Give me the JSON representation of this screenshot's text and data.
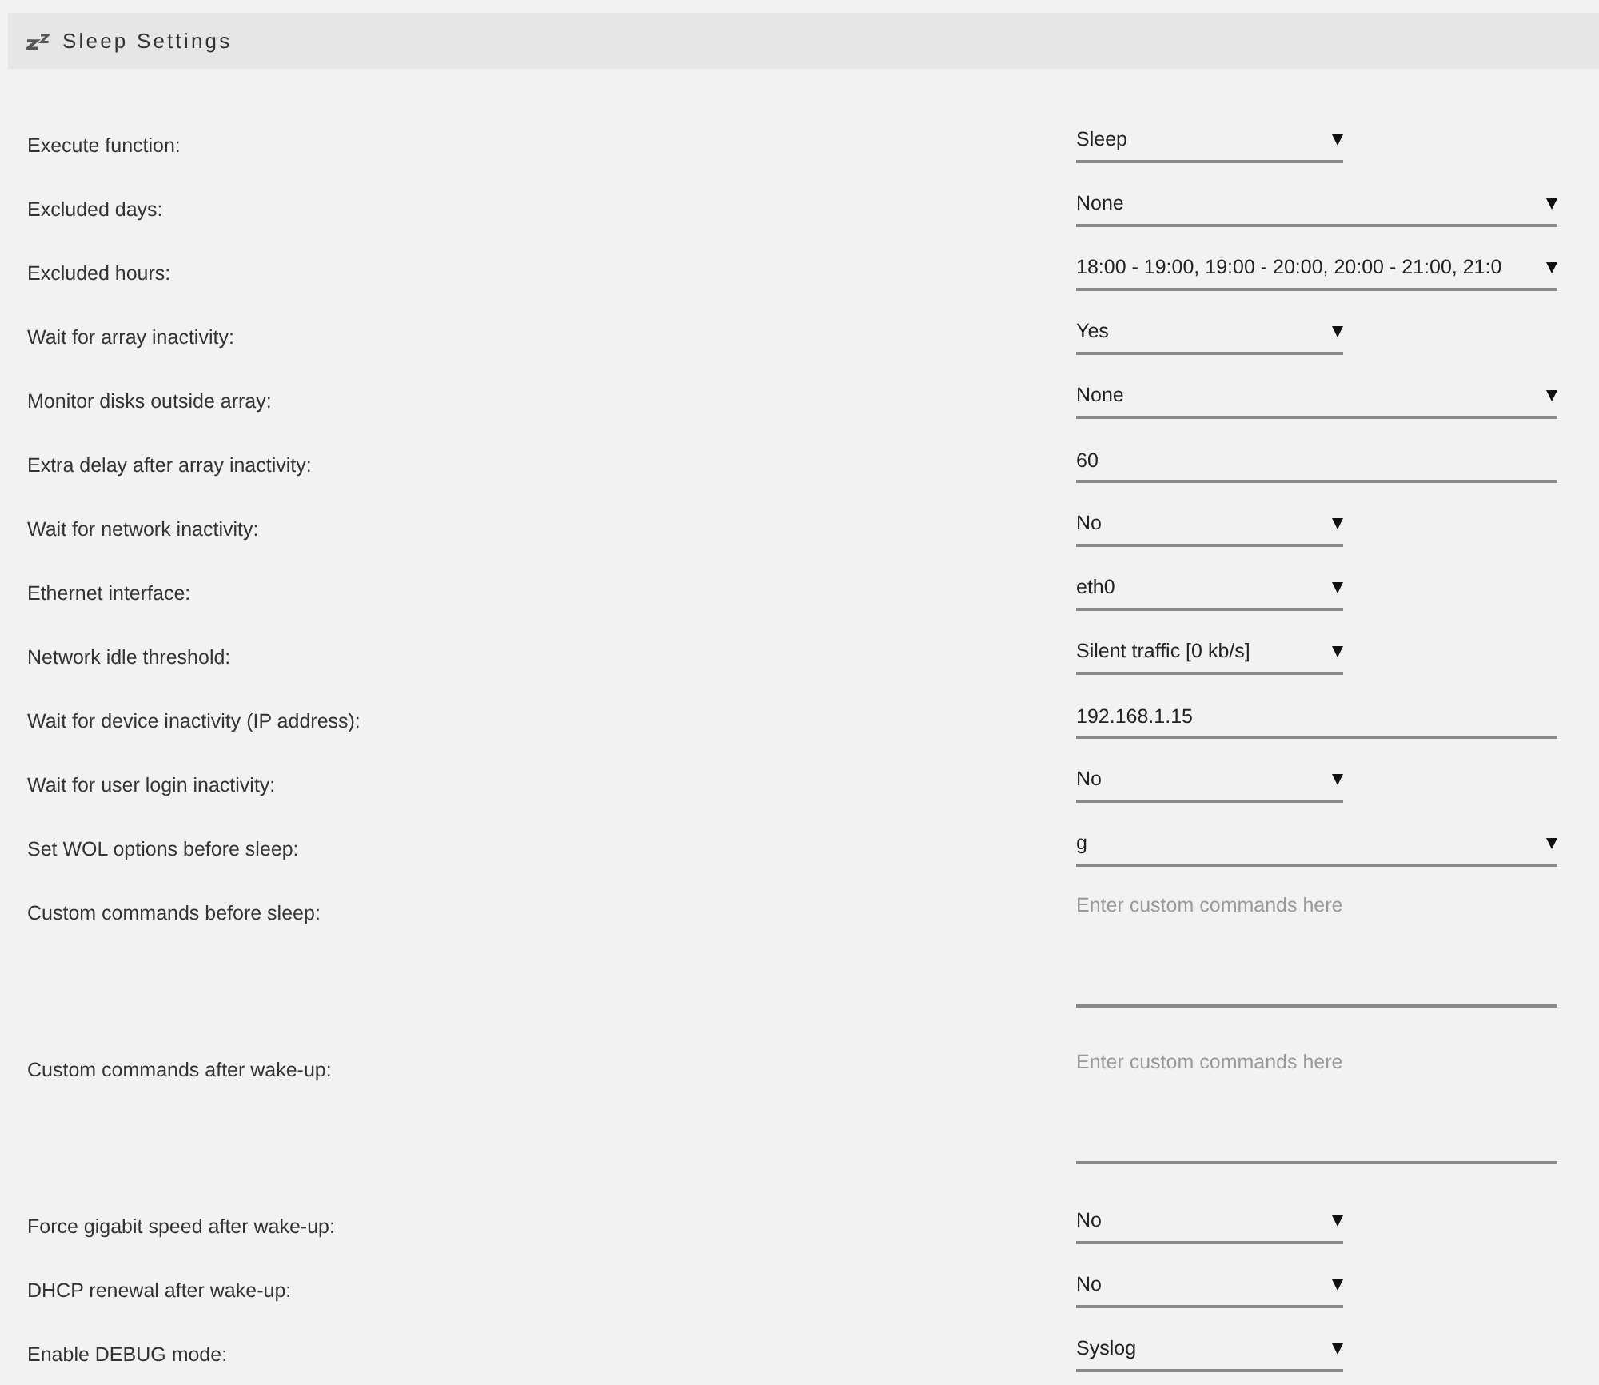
{
  "header": {
    "title": "Sleep Settings"
  },
  "settings": [
    {
      "label": "Execute function:",
      "kind": "select",
      "value": "Sleep",
      "wide": false
    },
    {
      "label": "Excluded days:",
      "kind": "select",
      "value": "None",
      "wide": true
    },
    {
      "label": "Excluded hours:",
      "kind": "select",
      "value": "18:00 - 19:00, 19:00 - 20:00, 20:00 - 21:00, 21:0",
      "wide": true
    },
    {
      "label": "Wait for array inactivity:",
      "kind": "select",
      "value": "Yes",
      "wide": false
    },
    {
      "label": "Monitor disks outside array:",
      "kind": "select",
      "value": "None",
      "wide": true
    },
    {
      "label": "Extra delay after array inactivity:",
      "kind": "text",
      "value": "60"
    },
    {
      "label": "Wait for network inactivity:",
      "kind": "select",
      "value": "No",
      "wide": false
    },
    {
      "label": "Ethernet interface:",
      "kind": "select",
      "value": "eth0",
      "wide": false
    },
    {
      "label": "Network idle threshold:",
      "kind": "select",
      "value": "Silent traffic [0 kb/s]",
      "wide": false
    },
    {
      "label": "Wait for device inactivity (IP address):",
      "kind": "text",
      "value": "192.168.1.15"
    },
    {
      "label": "Wait for user login inactivity:",
      "kind": "select",
      "value": "No",
      "wide": false
    },
    {
      "label": "Set WOL options before sleep:",
      "kind": "select",
      "value": "g",
      "wide": true
    },
    {
      "label": "Custom commands before sleep:",
      "kind": "textarea",
      "placeholder": "Enter custom commands here"
    },
    {
      "label": "Custom commands after wake-up:",
      "kind": "textarea",
      "placeholder": "Enter custom commands here"
    },
    {
      "label": "Force gigabit speed after wake-up:",
      "kind": "select",
      "value": "No",
      "wide": false
    },
    {
      "label": "DHCP renewal after wake-up:",
      "kind": "select",
      "value": "No",
      "wide": false
    },
    {
      "label": "Enable DEBUG mode:",
      "kind": "select",
      "value": "Syslog",
      "wide": false
    }
  ]
}
